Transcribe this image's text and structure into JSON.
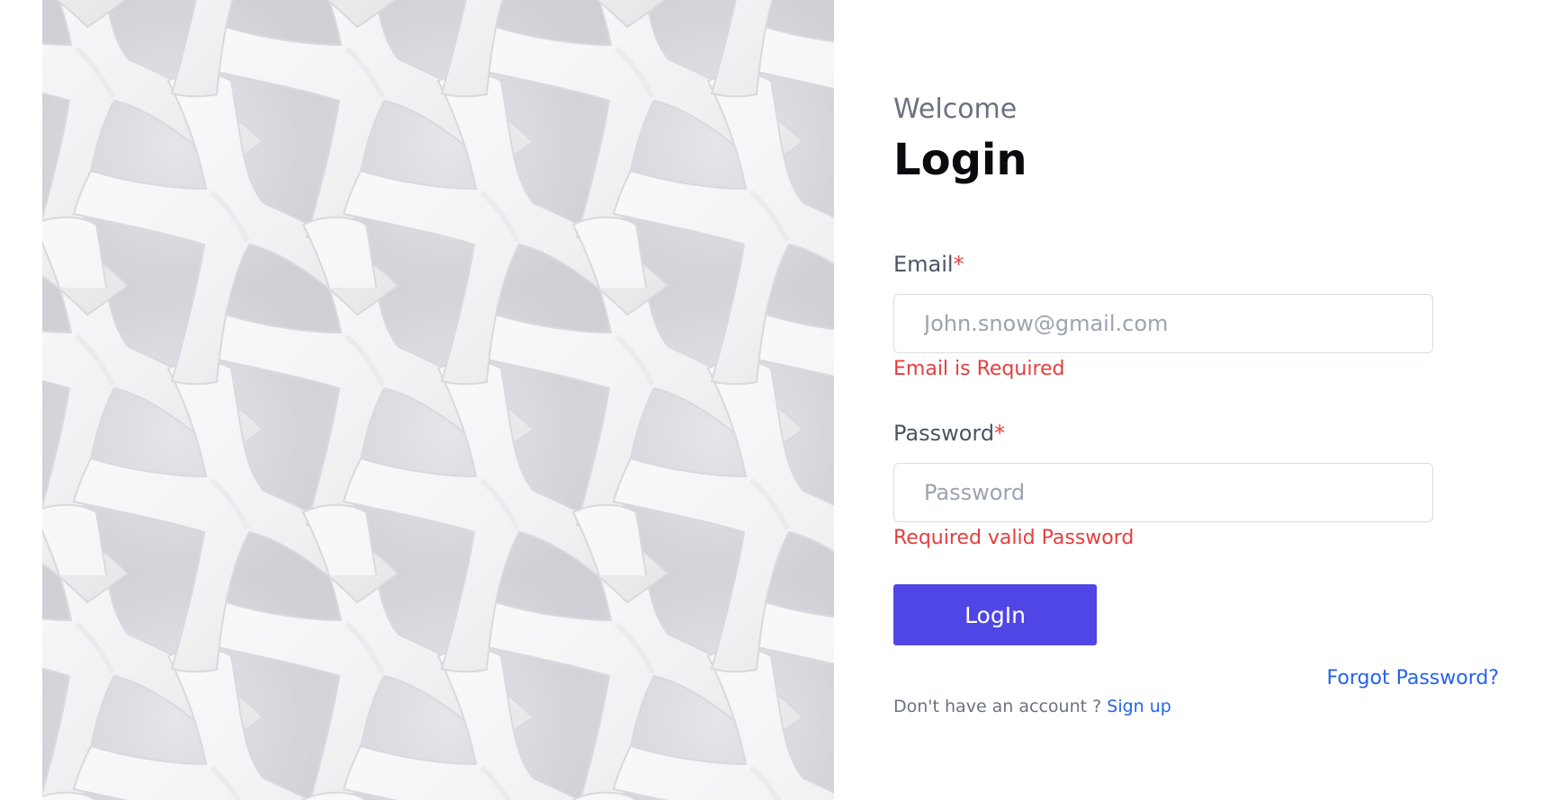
{
  "hero": {
    "image": "white woven abstract pattern"
  },
  "form": {
    "welcome": "Welcome",
    "title": "Login",
    "required_marker": "*",
    "email": {
      "label": "Email",
      "placeholder": "John.snow@gmail.com",
      "value": "",
      "error": "Email is Required"
    },
    "password": {
      "label": "Password",
      "placeholder": "Password",
      "value": "",
      "error": "Required valid Password"
    },
    "login_label": "LogIn",
    "forgot_label": "Forgot Password?",
    "signup_prompt": "Don't have an account ?",
    "signup_label": "Sign up"
  },
  "colors": {
    "accent": "#4f46e5",
    "link": "#2563eb",
    "error": "#e53e3e",
    "muted": "#6b7280"
  }
}
